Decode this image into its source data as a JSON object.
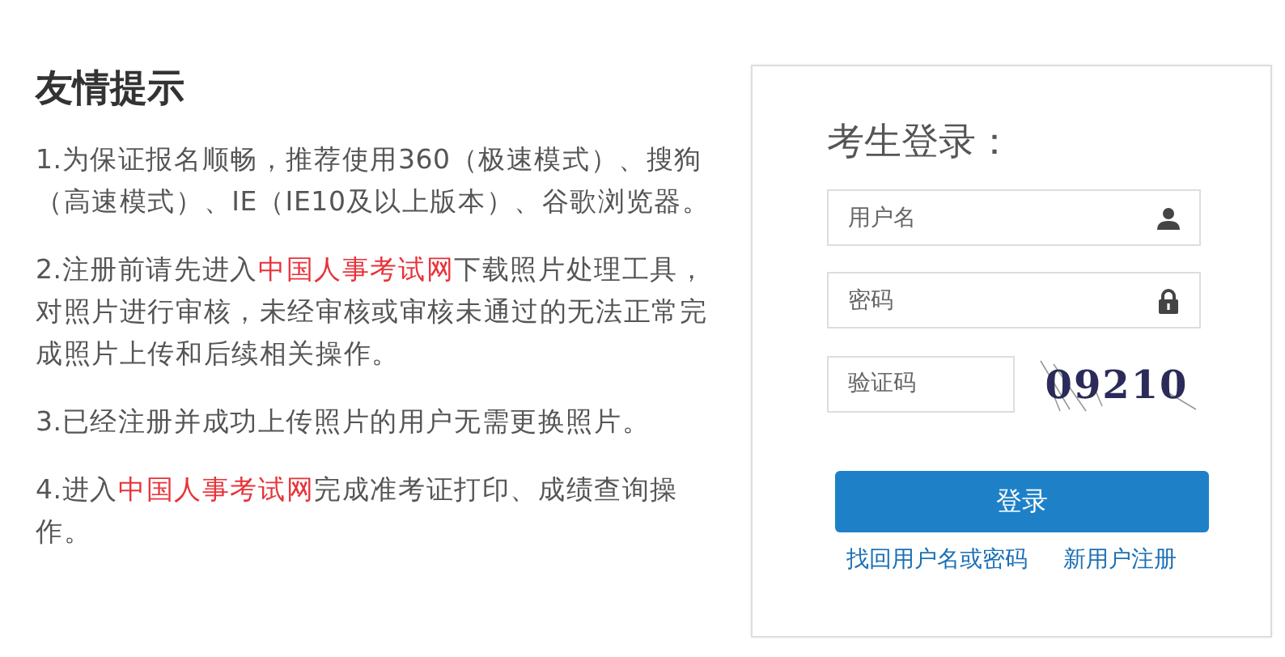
{
  "tips": {
    "title": "友情提示",
    "items": [
      {
        "segments": [
          {
            "kind": "text",
            "text": "1.为保证报名顺畅，推荐使用360（极速模式）、搜狗（高速模式）、IE（IE10及以上版本）、谷歌浏览器。"
          }
        ]
      },
      {
        "segments": [
          {
            "kind": "text",
            "text": "2.注册前请先进入"
          },
          {
            "kind": "link",
            "text": "中国人事考试网"
          },
          {
            "kind": "text",
            "text": "下载照片处理工具，对照片进行审核，未经审核或审核未通过的无法正常完成照片上传和后续相关操作。"
          }
        ]
      },
      {
        "segments": [
          {
            "kind": "text",
            "text": "3.已经注册并成功上传照片的用户无需更换照片。"
          }
        ]
      },
      {
        "segments": [
          {
            "kind": "text",
            "text": "4.进入"
          },
          {
            "kind": "link",
            "text": "中国人事考试网"
          },
          {
            "kind": "text",
            "text": "完成准考证打印、成绩查询操作。"
          }
        ]
      }
    ]
  },
  "login": {
    "title": "考生登录：",
    "fields": [
      {
        "kind": "user",
        "placeholder": "用户名"
      },
      {
        "kind": "password",
        "placeholder": "密码"
      }
    ],
    "captcha": {
      "placeholder": "验证码",
      "code": "09210"
    },
    "button": "登录",
    "links": [
      "找回用户名或密码",
      "新用户注册"
    ]
  }
}
